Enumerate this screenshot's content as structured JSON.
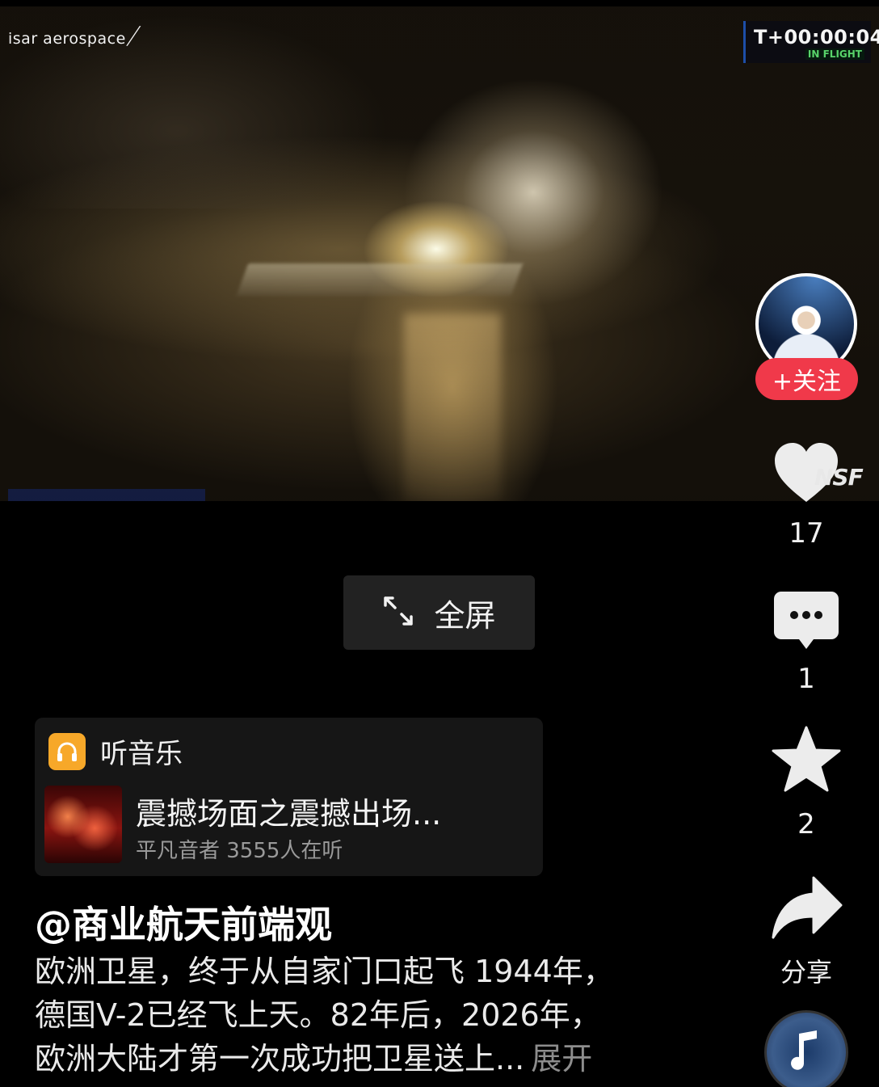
{
  "video": {
    "brand": "isar aerospace",
    "timer": "T+00:00:04",
    "timer_status": "IN FLIGHT"
  },
  "fullscreen_label": "全屏",
  "music": {
    "header": "听音乐",
    "song_title": "震撼场面之震撼出场...",
    "meta": "平凡音者 3555人在听"
  },
  "author": "@商业航天前端观",
  "description": {
    "lines": [
      "欧洲卫星，终于从自家门口起飞 1944年，",
      "德国V-2已经飞上天。82年后，2026年，",
      "欧洲大陆才第一次成功把卫星送上..."
    ],
    "expand_label": "展开"
  },
  "rail": {
    "follow_label": "+关注",
    "like_count": "17",
    "comment_count": "1",
    "favorite_count": "2",
    "share_label": "分享",
    "watermark": "NSF"
  },
  "colors": {
    "follow_bg": "#f0394a",
    "music_icon_bg": "#f7a829",
    "timer_status": "#58d36a"
  }
}
